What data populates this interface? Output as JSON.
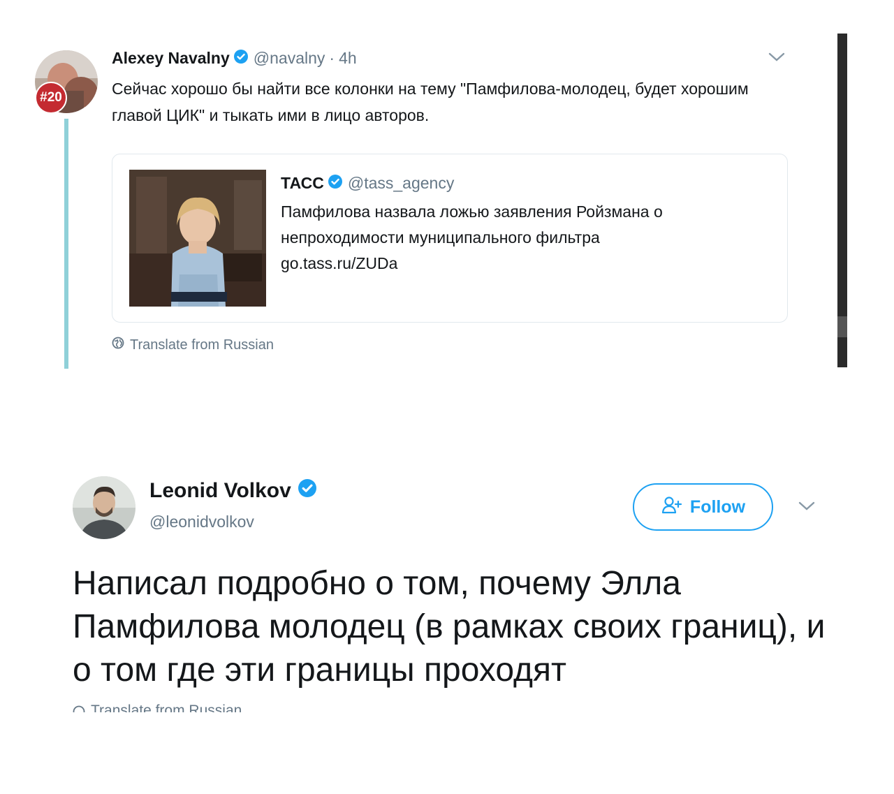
{
  "tweet1": {
    "author_name": "Alexey Navalny",
    "handle": "@navalny",
    "separator": "·",
    "time": "4h",
    "avatar_badge": "#20",
    "text": "Сейчас хорошо бы найти все колонки на тему \"Памфилова-молодец, будет хорошим главой ЦИК\" и тыкать ими в лицо авторов.",
    "quoted": {
      "author_name": "ТАСС",
      "handle": "@tass_agency",
      "text": "Памфилова назвала ложью заявления Ройзмана о непроходимости муниципального фильтра",
      "link": "go.tass.ru/ZUDa"
    },
    "translate_label": "Translate from Russian"
  },
  "tweet2": {
    "author_name": "Leonid Volkov",
    "handle": "@leonidvolkov",
    "follow_label": "Follow",
    "text": "Написал подробно о том, почему Элла Памфилова молодец (в рамках своих границ), и о том где эти границы проходят",
    "translate_label": "Translate from Russian"
  },
  "colors": {
    "accent": "#1da1f2",
    "secondary_text": "#657786",
    "thread_line": "#8fd0d8",
    "badge": "#c42b31"
  },
  "icons": [
    "verified-badge-icon",
    "chevron-down-icon",
    "globe-icon",
    "add-user-icon"
  ]
}
